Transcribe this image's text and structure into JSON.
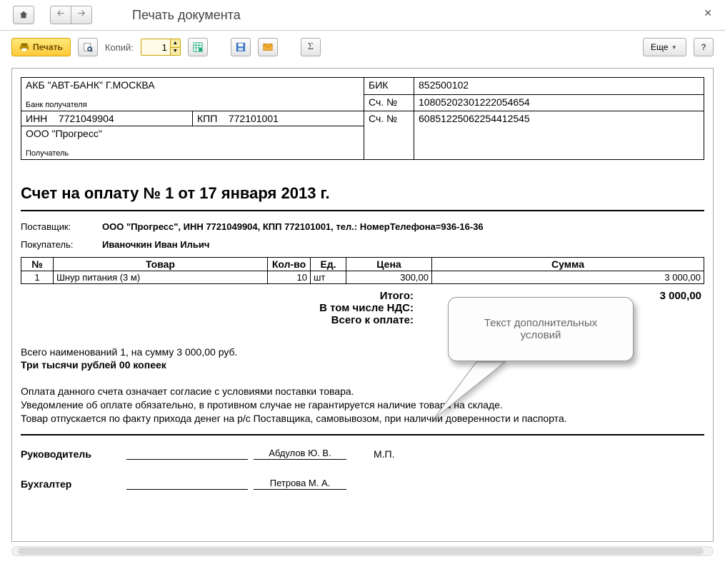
{
  "page": {
    "title": "Печать документа"
  },
  "toolbar": {
    "print_label": "Печать",
    "copies_label": "Копий:",
    "copies_value": "1",
    "more_label": "Еще",
    "help_label": "?"
  },
  "bank": {
    "bank_line": "АКБ \"АВТ-БАНК\" Г.МОСКВА",
    "bank_sub": "Банк получателя",
    "bik_label": "БИК",
    "bik_value": "852500102",
    "acct_label": "Сч. №",
    "corr_acct": "10805202301222054654",
    "inn_label": "ИНН",
    "inn_value": "7721049904",
    "kpp_label": "КПП",
    "kpp_value": "772101001",
    "acct2_label": "Сч. №",
    "recip_acct": "60851225062254412545",
    "payee_line": "ООО \"Прогресс\"",
    "payee_sub": "Получатель"
  },
  "invoice": {
    "title": "Счет на оплату № 1 от 17 января 2013 г.",
    "supplier_label": "Поставщик:",
    "supplier_value": "ООО \"Прогресс\", ИНН 7721049904, КПП 772101001,  тел.: НомерТелефона=936-16-36",
    "buyer_label": "Покупатель:",
    "buyer_value": "Иваночкин Иван Ильич"
  },
  "items": {
    "headers": {
      "num": "№",
      "name": "Товар",
      "qty": "Кол-во",
      "unit": "Ед.",
      "price": "Цена",
      "sum": "Сумма"
    },
    "rows": [
      {
        "num": "1",
        "name": "Шнур питания (3 м)",
        "qty": "10",
        "unit": "шт",
        "price": "300,00",
        "sum": "3 000,00"
      }
    ]
  },
  "totals": {
    "itogo_label": "Итого:",
    "itogo_value": "3 000,00",
    "nds_label": "В том числе НДС:",
    "total_label": "Всего к оплате:"
  },
  "summary": {
    "line": "Всего наименований 1, на сумму 3 000,00 руб.",
    "words": "Три тысячи рублей 00 копеек"
  },
  "conditions": {
    "l1": "Оплата данного счета означает согласие с условиями поставки товара.",
    "l2": "Уведомление об оплате обязательно, в противном случае не гарантируется наличие товара на складе.",
    "l3": "Товар отпускается по факту прихода денег на р/с Поставщика, самовывозом, при наличии доверенности и паспорта."
  },
  "signatures": {
    "director_label": "Руководитель",
    "director_name": "Абдулов Ю. В.",
    "mp": "М.П.",
    "accountant_label": "Бухгалтер",
    "accountant_name": "Петрова М. А."
  },
  "callout": {
    "text": "Текст дополнительных условий"
  }
}
